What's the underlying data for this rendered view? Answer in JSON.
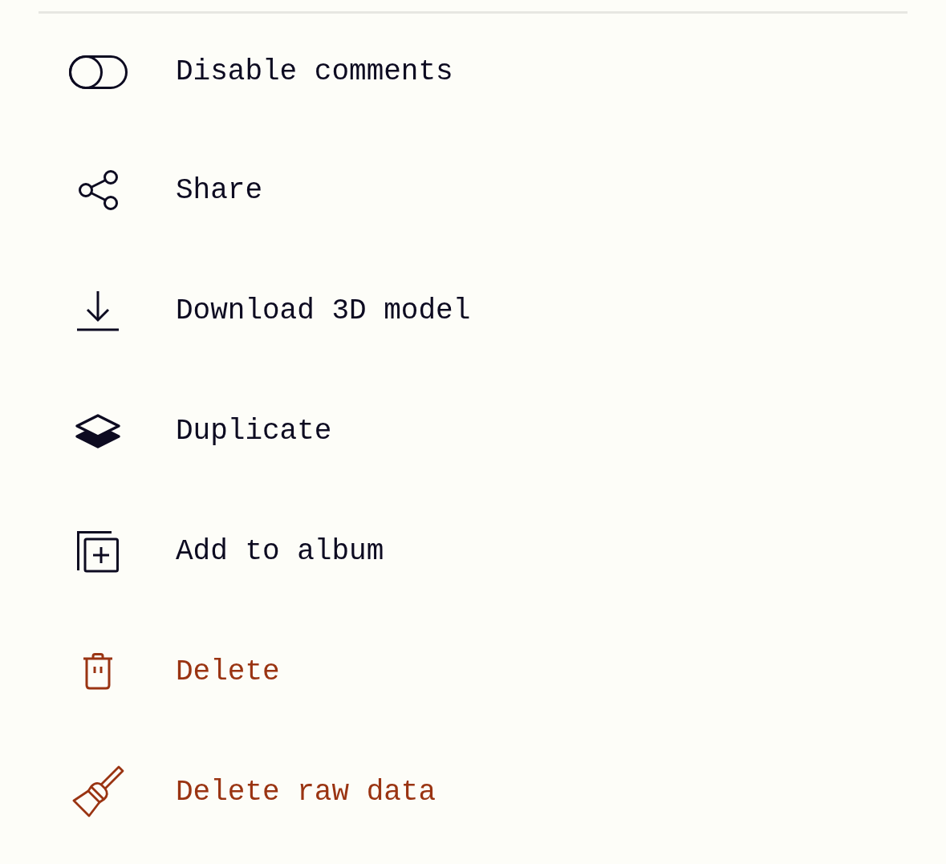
{
  "menu": {
    "items": [
      {
        "kind": "toggle",
        "label": "Disable comments",
        "on": false,
        "destructive": false
      },
      {
        "kind": "action",
        "label": "Share",
        "destructive": false
      },
      {
        "kind": "action",
        "label": "Download 3D model",
        "destructive": false
      },
      {
        "kind": "action",
        "label": "Duplicate",
        "destructive": false
      },
      {
        "kind": "action",
        "label": "Add to album",
        "destructive": false
      },
      {
        "kind": "action",
        "label": "Delete",
        "destructive": true
      },
      {
        "kind": "action",
        "label": "Delete raw data",
        "destructive": true
      }
    ]
  }
}
